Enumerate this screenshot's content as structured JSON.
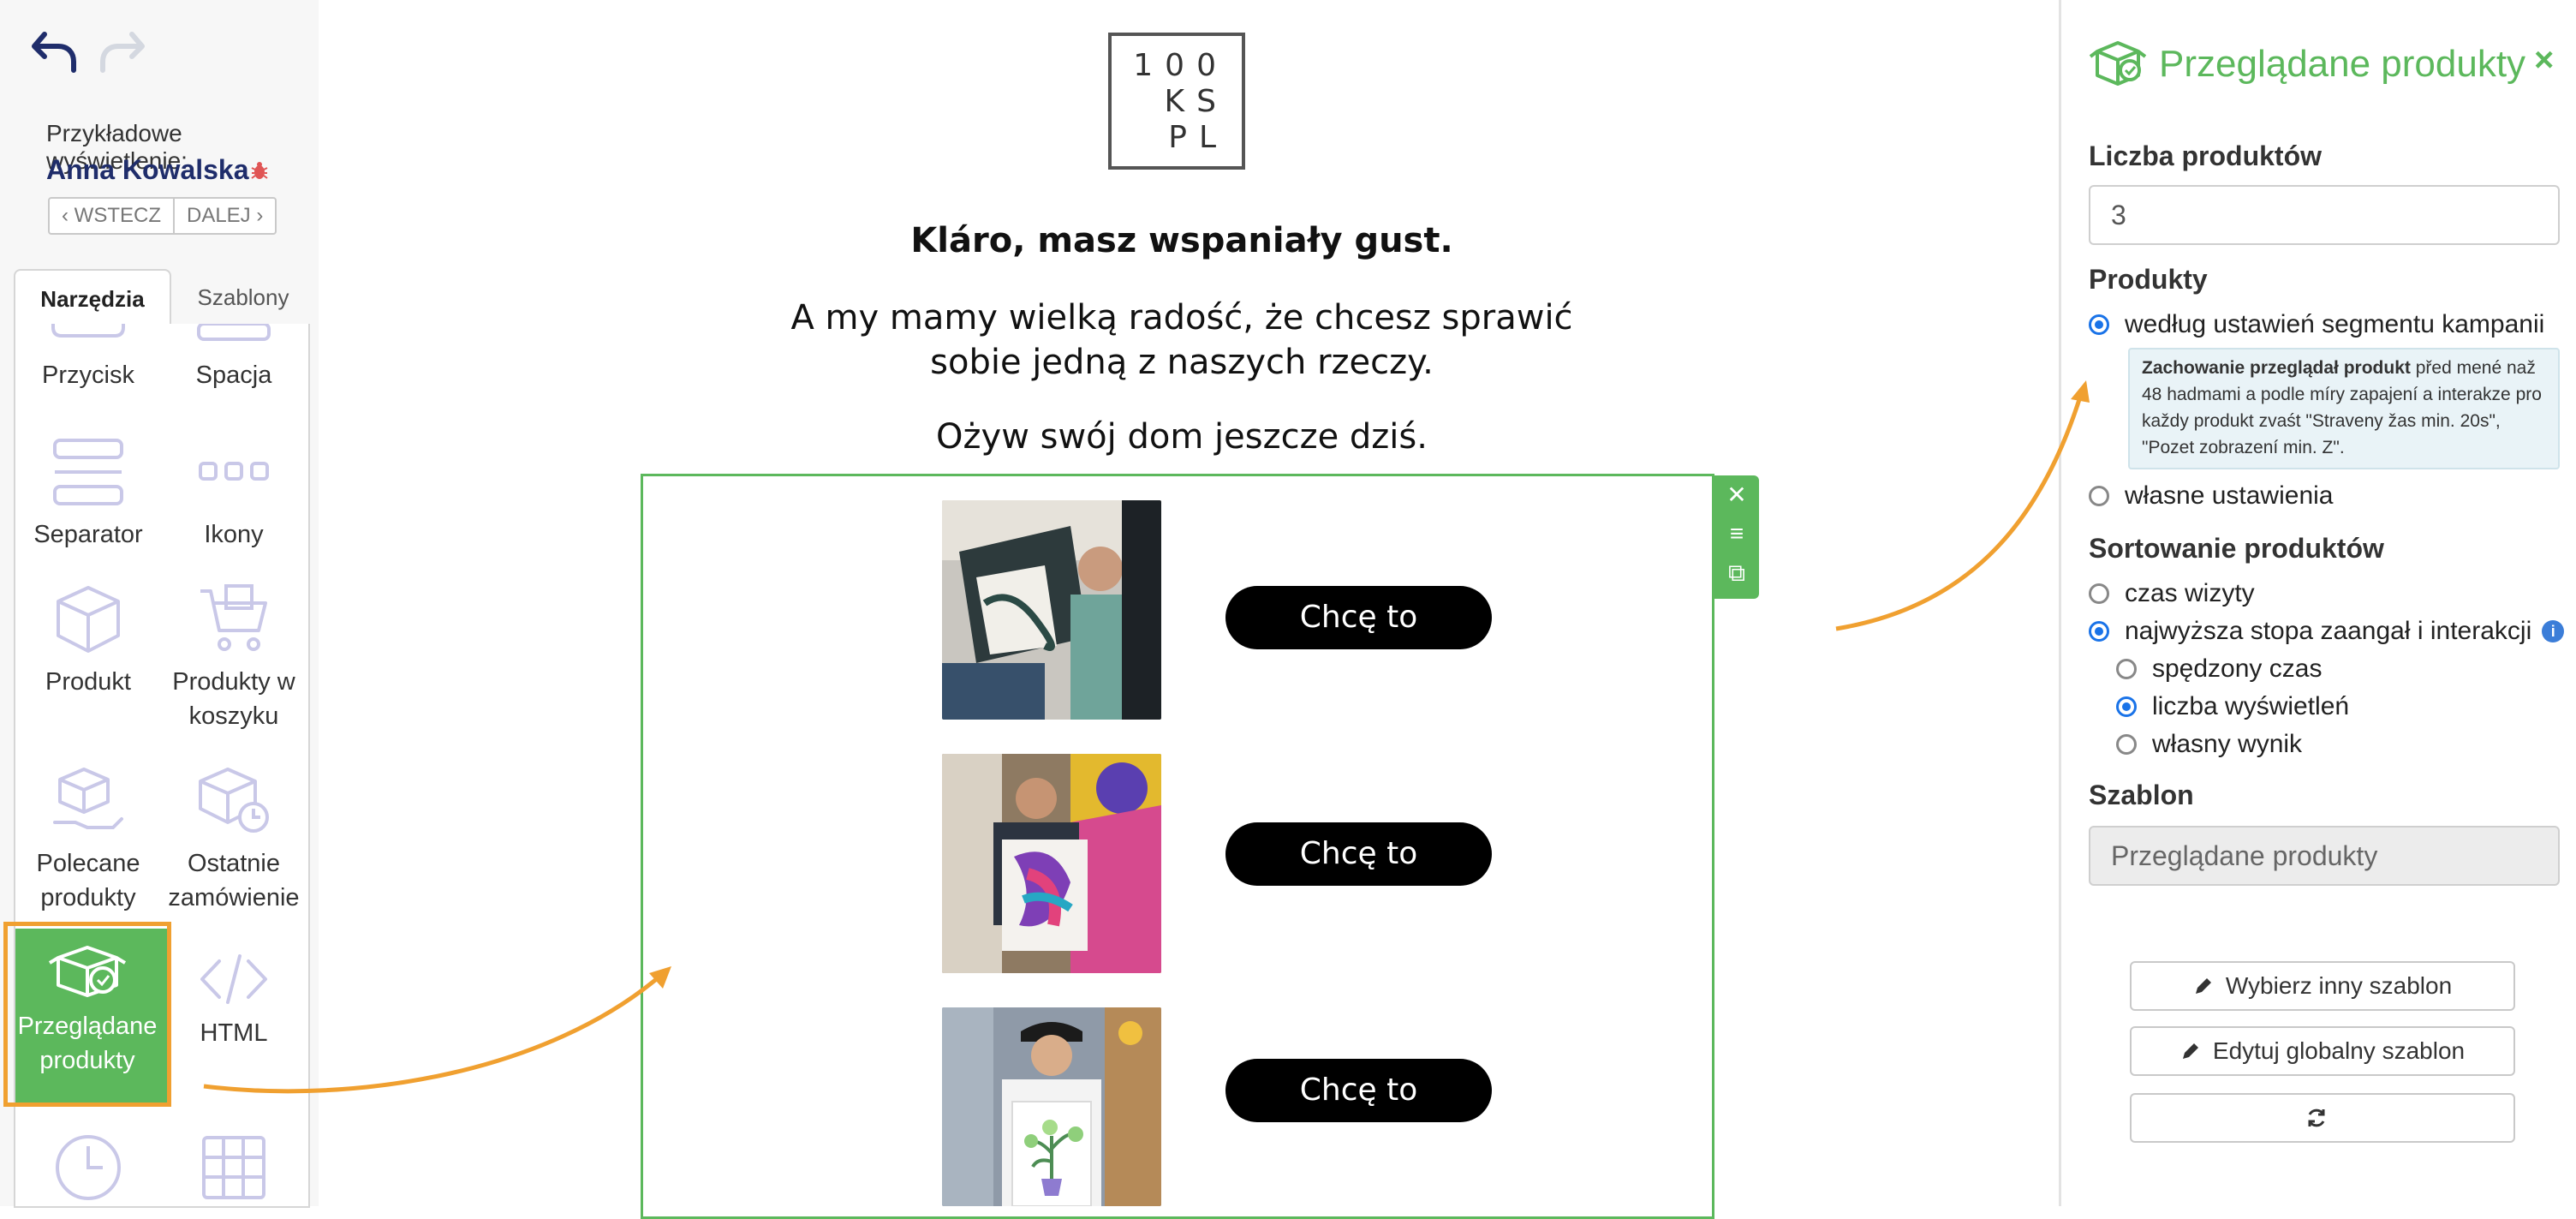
{
  "toolbar": {
    "undo_icon": "undo-arrow-icon",
    "redo_icon": "redo-arrow-icon",
    "preview_label": "Przykładowe wyświetlenie:",
    "preview_name": "Anna Kowalska",
    "back_label": "‹ WSTECZ",
    "next_label": "DALEJ ›"
  },
  "tabs": [
    {
      "label": "Narzędzia",
      "active": true
    },
    {
      "label": "Szablony",
      "active": false
    }
  ],
  "tools": [
    {
      "label": "Przycisk",
      "icon": "button-icon"
    },
    {
      "label": "Spacja",
      "icon": "spacer-icon"
    },
    {
      "label": "Separator",
      "icon": "separator-icon"
    },
    {
      "label": "Ikony",
      "icon": "icons-icon"
    },
    {
      "label": "Produkt",
      "icon": "box-icon"
    },
    {
      "label": "Produkty w koszyku",
      "icon": "cart-icon"
    },
    {
      "label": "Polecane produkty",
      "icon": "hand-box-icon"
    },
    {
      "label": "Ostatnie zamówienie",
      "icon": "box-clock-icon"
    },
    {
      "label": "Przeglądane produkty",
      "icon": "viewed-products-icon",
      "active": true
    },
    {
      "label": "HTML",
      "icon": "code-icon"
    },
    {
      "label": "",
      "icon": "clock-icon"
    },
    {
      "label": "",
      "icon": "table-icon"
    }
  ],
  "canvas": {
    "logo_lines": [
      "100",
      "KS",
      "PL"
    ],
    "headline": "Kláro, masz wspaniały gust.",
    "subline_1": "A my mamy wielką radość, że chcesz sprawić",
    "subline_2": "sobie jedną z naszych rzeczy.",
    "subline_3": "Ożyw swój dom jeszcze dziś.",
    "products": [
      {
        "cta": "Chcę to"
      },
      {
        "cta": "Chcę to"
      },
      {
        "cta": "Chcę to"
      }
    ],
    "block_actions": [
      "close-icon",
      "menu-icon",
      "duplicate-icon"
    ]
  },
  "panel": {
    "title": "Przeglądane produkty",
    "close": "×",
    "count_label": "Liczba produktów",
    "count_value": "3",
    "products_label": "Produkty",
    "opt_segment": "według ustawień segmentu kampanii",
    "note_bold": "Zachowanie przeglądał produkt",
    "note_text": " před mené naž 48 hadmami a podle míry zapajení a interakze pro každy produkt zvaśt \"Straveny žas min. 20s\", \"Pozet zobrazení min. Z\".",
    "opt_custom": "własne ustawienia",
    "sort_label": "Sortowanie produktów",
    "sort_visit": "czas wizyty",
    "sort_engagement": "najwyższa stopa zaangał i interakcji",
    "sub_time": "spędzony czas",
    "sub_views": "liczba wyświetleń",
    "sub_score": "własny wynik",
    "template_label": "Szablon",
    "template_value": "Przeglądane produkty",
    "btn_choose": "Wybierz inny szablon",
    "btn_edit": "Edytuj globalny szablon"
  },
  "colors": {
    "accent_green": "#5cb85c",
    "highlight_orange": "#f0a030",
    "radio_blue": "#1a73e8",
    "name_navy": "#1f2d6b"
  }
}
